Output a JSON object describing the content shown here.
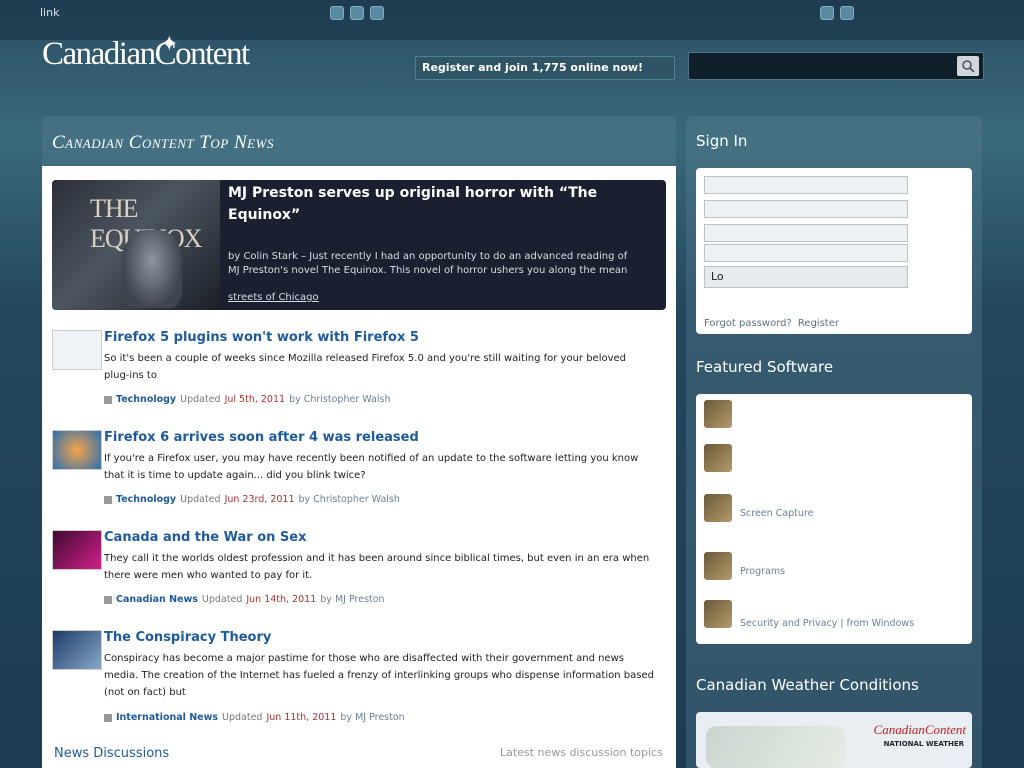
{
  "header": {
    "top_link": "link",
    "logo_text": "CanadianContent",
    "register_text": "Register and join 1,775 online now!",
    "search_placeholder": ""
  },
  "main": {
    "heading": "Canadian Content Top News",
    "feature": {
      "title": "MJ Preston serves up original horror with “The Equinox”",
      "text": "by Colin Stark – Just recently I had an opportunity to do an advanced reading of MJ Preston's novel The Equinox. This novel of horror ushers you along the mean",
      "link": "streets of Chicago",
      "image_label": "THE EQUINOX"
    },
    "articles": [
      {
        "title": "Firefox 5 plugins won't work with Firefox 5",
        "text": "So it's been a couple of weeks since Mozilla released Firefox 5.0 and you're still waiting for your beloved plug-ins to",
        "category": "Technology",
        "updated": "Updated",
        "date": "Jul 5th, 2011",
        "author": "by Christopher Walsh"
      },
      {
        "title": "Firefox 6 arrives soon after 4 was released",
        "text": "If you're a Firefox user, you may have recently been notified of an update to the software letting you know that it is time to update again... did you blink twice?",
        "category": "Technology",
        "updated": "Updated",
        "date": "Jun 23rd, 2011",
        "author": "by Christopher Walsh"
      },
      {
        "title": "Canada and the War on Sex",
        "text": "They call it the worlds oldest profession and it has been around since biblical times, but even in an era when there were men who wanted to pay for it.",
        "category": "Canadian News",
        "updated": "Updated",
        "date": "Jun 14th, 2011",
        "author": "by MJ Preston"
      },
      {
        "title": "The Conspiracy Theory",
        "text": "Conspiracy has become a major pastime for those who are disaffected with their government and news media. The creation of the Internet has fueled a frenzy of interlinking groups who dispense information based (not on fact) but",
        "category": "International News",
        "updated": "Updated",
        "date": "Jun 11th, 2011",
        "author": "by MJ Preston"
      }
    ],
    "news_discussions": "News Discussions",
    "latest_topics": "Latest news discussion topics"
  },
  "sidebar": {
    "signin_heading": "Sign In",
    "login_button": "Lo",
    "forgot_password": "Forgot password?",
    "register": "Register",
    "featured_heading": "Featured Software",
    "featured": [
      {
        "title": "",
        "sub": ""
      },
      {
        "title": "",
        "sub": ""
      },
      {
        "title": "",
        "sub": "Screen Capture"
      },
      {
        "title": "",
        "sub": "Programs"
      },
      {
        "title": "",
        "sub": "Security and Privacy | from Windows"
      }
    ],
    "weather_heading": "Canadian Weather Conditions",
    "weather_brand": "CanadianContent",
    "weather_sub": "NATIONAL WEATHER"
  }
}
